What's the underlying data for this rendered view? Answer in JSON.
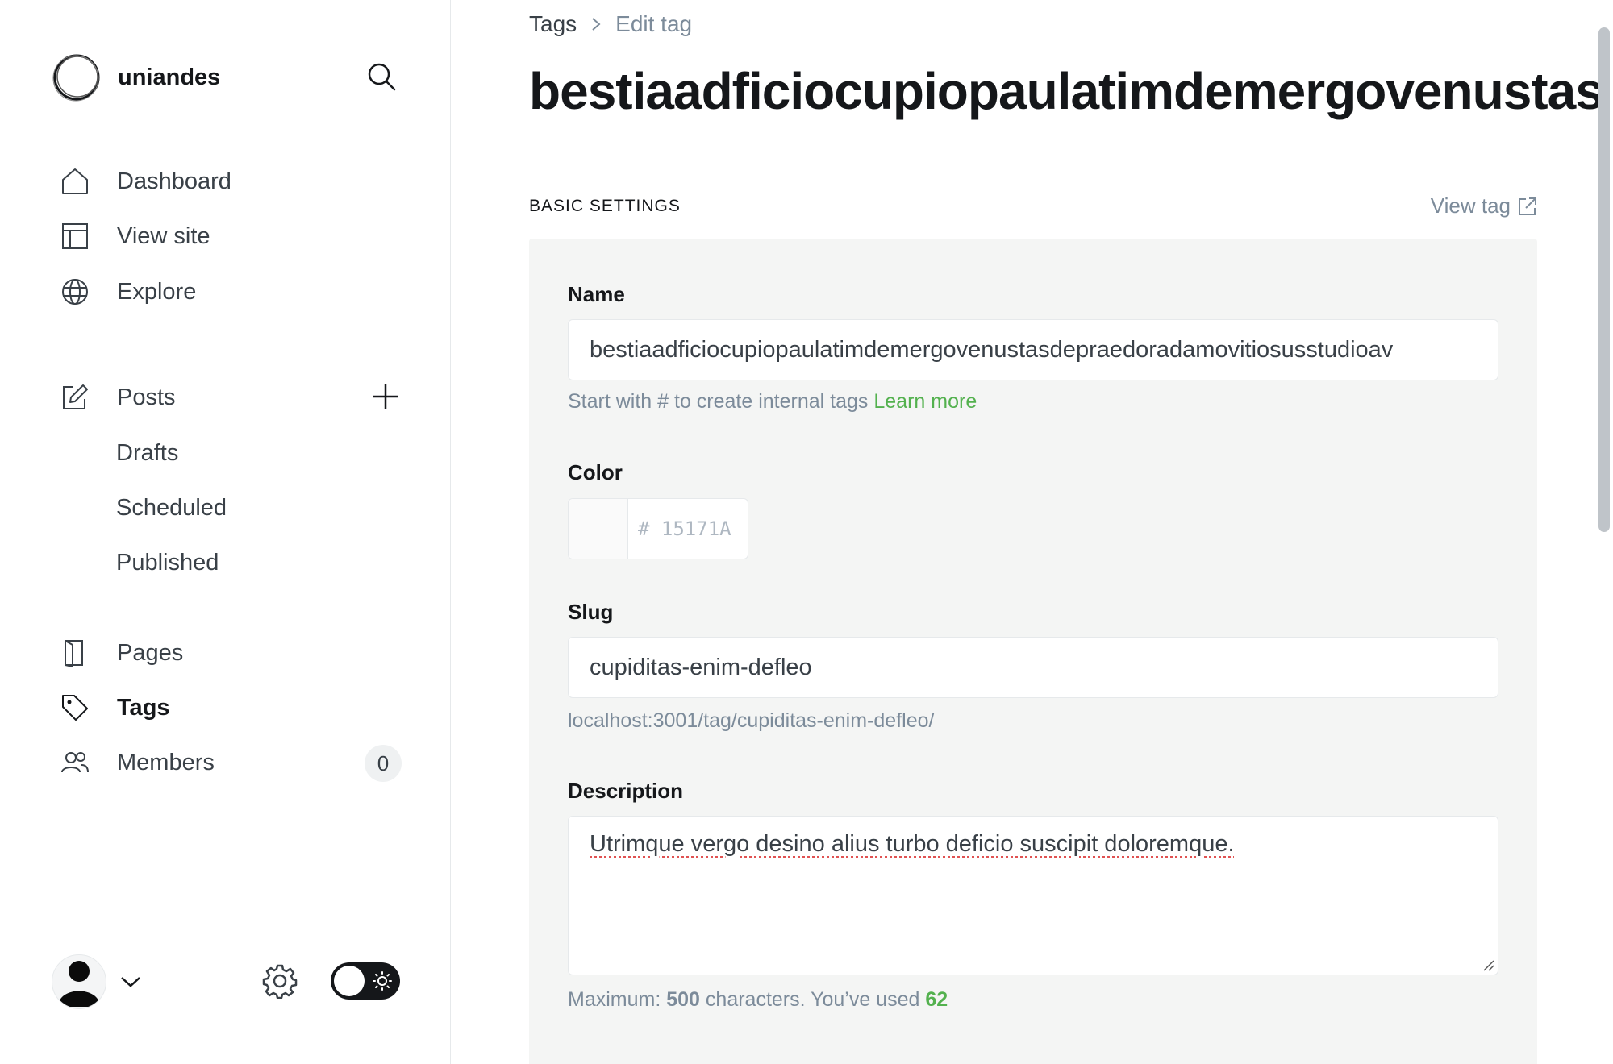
{
  "sidebar": {
    "brand_name": "uniandes",
    "nav": {
      "dashboard": "Dashboard",
      "view_site": "View site",
      "explore": "Explore",
      "posts": "Posts",
      "drafts": "Drafts",
      "scheduled": "Scheduled",
      "published": "Published",
      "pages": "Pages",
      "tags": "Tags",
      "members": "Members",
      "members_count": "0"
    },
    "icons": [
      "search-icon",
      "home-icon",
      "layout-icon",
      "globe-icon",
      "edit-icon",
      "plus-icon",
      "page-icon",
      "tag-icon",
      "members-icon",
      "user-icon",
      "chevron-down-icon",
      "gear-icon",
      "sun-icon"
    ]
  },
  "main": {
    "breadcrumb": {
      "parent": "Tags",
      "current": "Edit tag"
    },
    "title": "bestiaadficiocupiopaulatimdemergovenustas",
    "section_heading": "BASIC SETTINGS",
    "view_tag_label": "View tag",
    "fields": {
      "name_label": "Name",
      "name_value": "bestiaadficiocupiopaulatimdemergovenustasdepraedoradamovitiosusstudioav",
      "name_hint": "Start with # to create internal tags",
      "name_hint_link": "Learn more",
      "color_label": "Color",
      "color_placeholder": "# 15171A",
      "slug_label": "Slug",
      "slug_value": "cupiditas-enim-defleo",
      "slug_url": "localhost:3001/tag/cupiditas-enim-defleo/",
      "description_label": "Description",
      "description_value": "Utrimque vergo desino alius turbo deficio suscipit doloremque.",
      "desc_hint_prefix": "Maximum:",
      "desc_hint_max": "500",
      "desc_hint_middle": "characters. You’ve used",
      "desc_hint_used": "62"
    }
  },
  "colors": {
    "accent_green": "#53b14e",
    "text_dark": "#15171a",
    "muted": "#7c8b9a",
    "panel_bg": "#f4f5f4"
  }
}
